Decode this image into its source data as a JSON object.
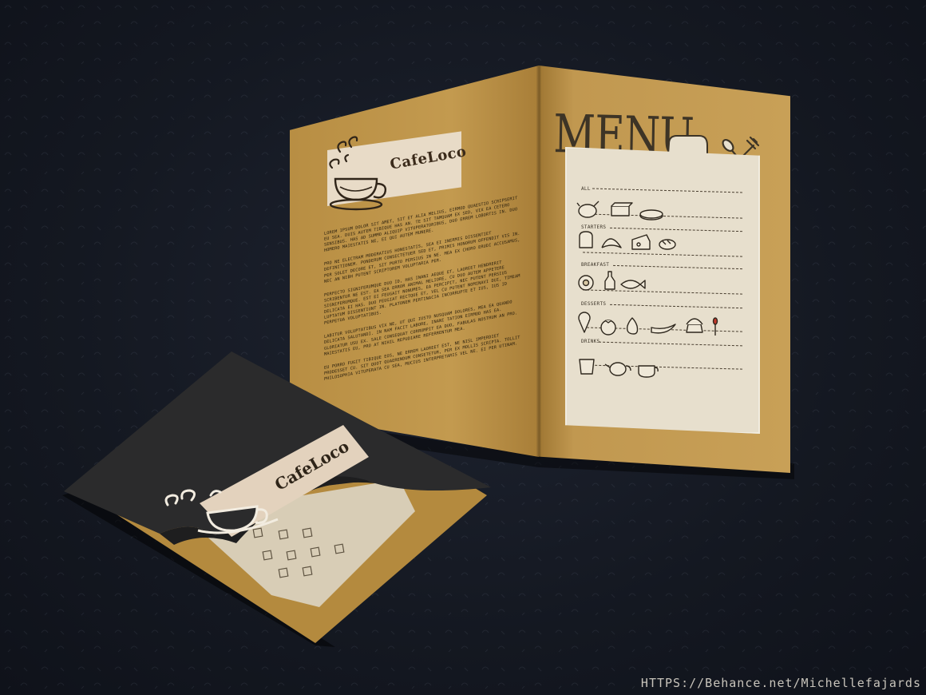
{
  "brand": {
    "name": "CafeLoco"
  },
  "menu": {
    "title": "MENU",
    "sections": [
      {
        "label": "ALL",
        "icons": [
          "roast-chicken-icon",
          "butter-icon",
          "pizza-slice-icon"
        ]
      },
      {
        "label": "STARTERS",
        "icons": [
          "toast-icon",
          "croissant-icon",
          "cheese-icon",
          "bread-icon"
        ]
      },
      {
        "label": "BREAKFAST",
        "icons": [
          "fried-egg-icon",
          "bottle-icon",
          "fish-icon"
        ]
      },
      {
        "label": "DESSERTS",
        "icons": [
          "ice-cream-icon",
          "tomato-icon",
          "pear-icon",
          "banana-icon",
          "cupcake-icon",
          "match-icon"
        ]
      },
      {
        "label": "DRINKS",
        "icons": [
          "glass-icon",
          "teapot-icon",
          "teacup-icon"
        ]
      }
    ]
  },
  "body_paragraphs": [
    "Lorem ipsum dolor sit amet, sit et alia melius, eirmod quaestio scripserit eu sea. Duis autem tibique has an. Te sit tamquam ex sed, vix ea cetero sensibus. Has ad summo aliquip vituperatoribus, duo errem lobortis in. Duo homero maiestatis ne, ei qui autem munere.",
    "Pro ne electram moderatius honestatis, sea ei inermis dissentiet definitionem. Ponderum consectetuer sed et, primis honorum offendit vis in. Per solet decore et, sit purto persius in ne. Mea ex choro erudi accusamus, nec an nibh putent scriptorem voluptaria per.",
    "Perfecto signiferumque duo id, has inani aeque et, laoreet hendrerit scribentur ne est. Ea sea error animal meliore, cu duo autem appetere signiferumque. Est ei feugait nonumes, ea percipit, nec putent persius delicata ei has. Duo feugiat rectque et, vel cu putent nominavi dui, timeam luptatum dissentiunt in. Platonem pertinacia incorrupte et ius, ius id perpetua voluptatibus.",
    "Labitur voluptatibus vix ne, ut qui iusto nusquam dolores, mea ea quando delicata salutandi. In nam facit labore, inani tation eirmod has ea. Gloriatur usu ex. Sale consequat corrumpit ea duo, fabulas nostrum an pro. Maiestatis eu, pro at nihil repudiare referrentur mea.",
    "Eu porro fugit tibique eos, ne errem laoreet est, ne nisl imperdiet prodesset cu. Sit quot quaerendum consetetur, per ex mollis scripta. Tollit philosophia vituperata cu sea, mucius interpretaris vel ne. Ei per utinam."
  ],
  "watermark": "HTTPS://Behance.net/Michellefajards",
  "colors": {
    "background": "#161a24",
    "kraft": "#c39a4f",
    "cream": "#e7dfcd",
    "cover_dark": "#2b2b2c",
    "ink": "#3d3426"
  }
}
